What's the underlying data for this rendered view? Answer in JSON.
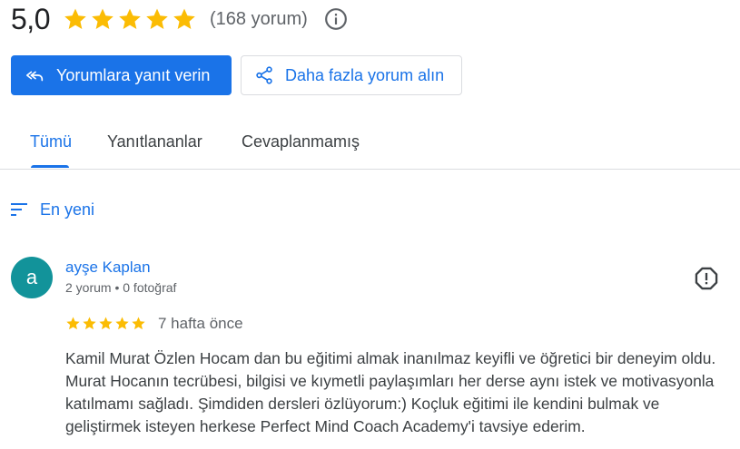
{
  "summary": {
    "rating": "5,0",
    "stars": 5,
    "count_text": "(168 yorum)",
    "info_icon": "info-icon"
  },
  "actions": {
    "reply_label": "Yorumlara yanıt verin",
    "reply_icon": "reply-all-icon",
    "more_reviews_label": "Daha fazla yorum alın",
    "share_icon": "share-icon"
  },
  "tabs": [
    {
      "label": "Tümü",
      "active": true
    },
    {
      "label": "Yanıtlananlar",
      "active": false
    },
    {
      "label": "Cevaplanmamış",
      "active": false
    }
  ],
  "sort": {
    "label": "En yeni",
    "icon": "sort-icon"
  },
  "review": {
    "avatar_letter": "a",
    "avatar_color": "#12939a",
    "author": "ayşe Kaplan",
    "meta": "2 yorum • 0 fotoğraf",
    "stars": 5,
    "time": "7 hafta önce",
    "text": "Kamil Murat Özlen Hocam dan bu eğitimi almak inanılmaz keyifli ve öğretici bir deneyim oldu. Murat Hocanın tecrübesi, bilgisi ve kıymetli paylaşımları her derse aynı istek ve motivasyonla katılmamı sağladı. Şimdiden dersleri özlüyorum:) Koçluk eğitimi ile kendini bulmak ve geliştirmek isteyen herkese Perfect Mind Coach Academy'i tavsiye ederim.",
    "report_icon": "report-icon"
  },
  "colors": {
    "accent": "#1a73e8",
    "star": "#fbbc04",
    "text_secondary": "#5f6368"
  }
}
